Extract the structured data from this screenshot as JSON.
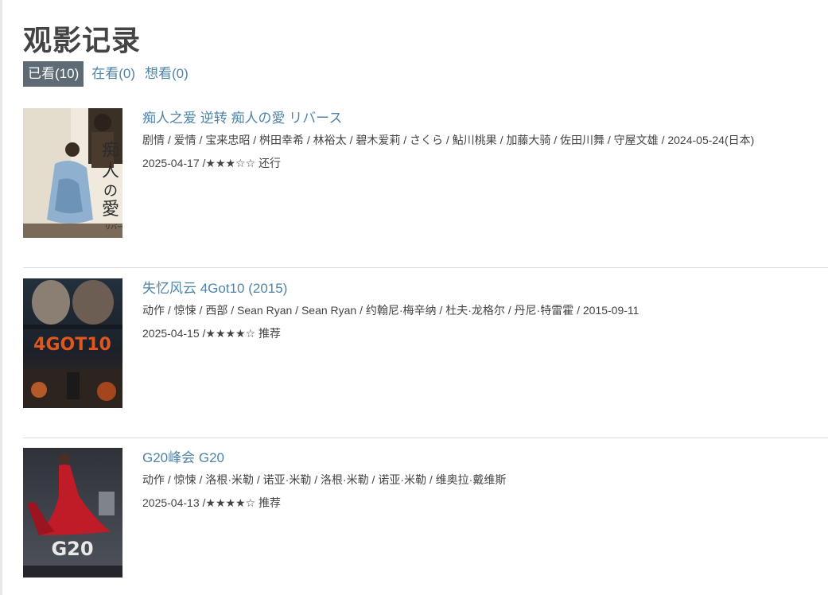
{
  "page_title": "观影记录",
  "tabs": [
    {
      "label": "已看(10)",
      "active": true
    },
    {
      "label": "在看(0)",
      "active": false
    },
    {
      "label": "想看(0)",
      "active": false
    }
  ],
  "movies": [
    {
      "title": "痴人之爱 逆转 痴人の愛 リバース",
      "meta": "剧情 / 爱情 / 宝来忠昭 / 桝田幸希 / 林裕太 / 碧木爱莉 / さくら / 鮎川桃果 / 加藤大骑 / 佐田川舞 / 守屋文雄 / 2024-05-24(日本)",
      "rating_line": "2025-04-17 /★★★☆☆ 还行",
      "poster_text": "痴人の愛 リバース",
      "poster_colors": [
        "#efe9de",
        "#6b5b4c",
        "#7fa7c8"
      ]
    },
    {
      "title": "失忆风云 4Got10 (2015)",
      "meta": "动作 / 惊悚 / 西部 / Sean Ryan / Sean Ryan / 约翰尼·梅辛纳 / 杜夫·龙格尔 / 丹尼·特雷霍 / 2015-09-11",
      "rating_line": "2025-04-15 /★★★★☆ 推荐",
      "poster_text": "4GOT10",
      "poster_colors": [
        "#1e2a36",
        "#d4501f",
        "#b5452a"
      ]
    },
    {
      "title": "G20峰会 G20",
      "meta": "动作 / 惊悚 / 洛根·米勒 / 诺亚·米勒 / 洛根·米勒 / 诺亚·米勒 / 维奥拉·戴维斯",
      "rating_line": "2025-04-13 /★★★★☆ 推荐",
      "poster_text": "G20",
      "poster_colors": [
        "#3b3d44",
        "#c01c28",
        "#8a8f99"
      ]
    }
  ]
}
